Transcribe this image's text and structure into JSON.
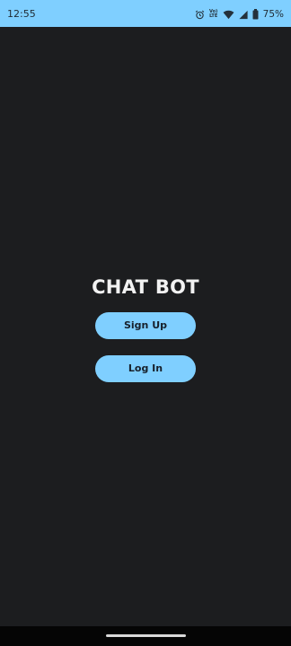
{
  "status_bar": {
    "time": "12:55",
    "volte_line1": "Vo)",
    "volte_line2": "LTE",
    "battery_percent": "75%"
  },
  "app": {
    "title": "CHAT BOT"
  },
  "buttons": {
    "sign_up": "Sign Up",
    "log_in": "Log In"
  },
  "colors": {
    "accent": "#7fcfff",
    "background": "#1c1d1f",
    "title_text": "#f2f2f2",
    "button_text": "#17202b"
  }
}
